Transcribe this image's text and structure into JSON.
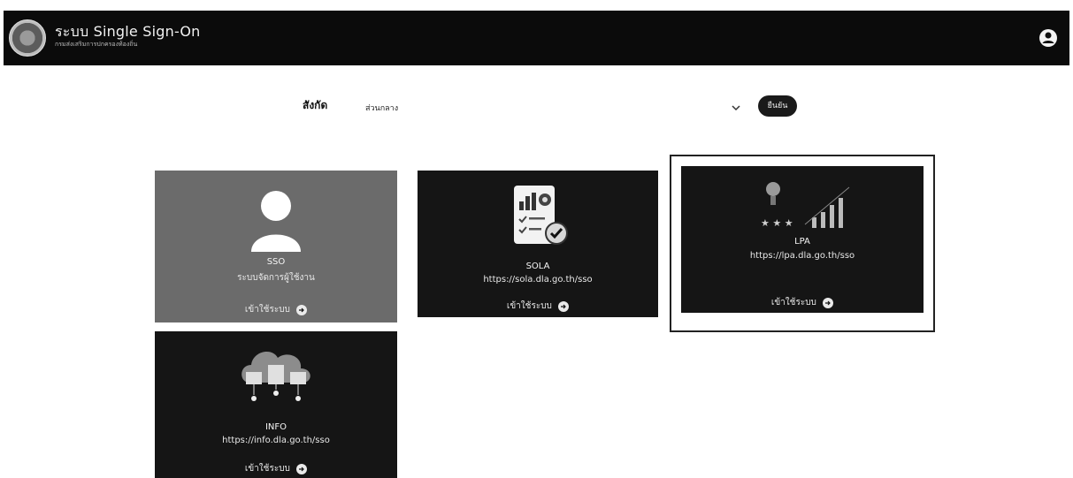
{
  "header": {
    "title": "ระบบ Single Sign-On",
    "subtitle": "กรมส่งเสริมการปกครองท้องถิ่น",
    "user_icon": "user-circle-icon"
  },
  "filter": {
    "label": "สังกัด",
    "selected": "ส่วนกลาง",
    "confirm_label": "ยืนยัน"
  },
  "cards": [
    {
      "title": "SSO",
      "subtitle": "ระบบจัดการผู้ใช้งาน",
      "enter_label": "เข้าใช้ระบบ",
      "icon": "user-icon"
    },
    {
      "title": "SOLA",
      "subtitle": "https://sola.dla.go.th/sso",
      "enter_label": "เข้าใช้ระบบ",
      "icon": "checklist-report-icon"
    },
    {
      "title": "LPA",
      "subtitle": "https://lpa.dla.go.th/sso",
      "enter_label": "เข้าใช้ระบบ",
      "icon": "award-rating-icon"
    },
    {
      "title": "INFO",
      "subtitle": "https://info.dla.go.th/sso",
      "enter_label": "เข้าใช้ระบบ",
      "icon": "cloud-network-icon"
    }
  ]
}
